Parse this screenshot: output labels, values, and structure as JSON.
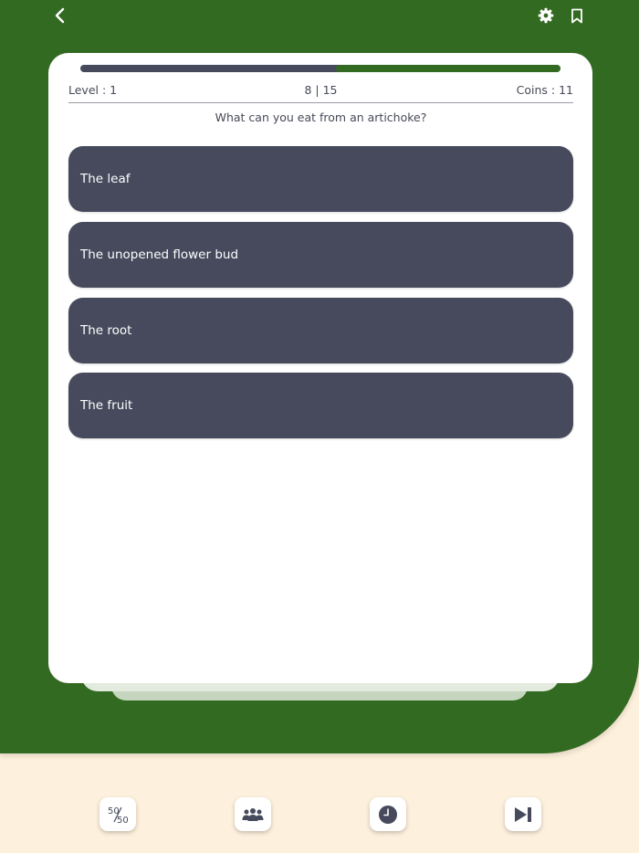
{
  "header": {
    "back_icon": "chevron-left-icon",
    "settings_icon": "gear-icon",
    "bookmark_icon": "bookmark-icon"
  },
  "progress": {
    "current": 8,
    "total": 15,
    "color_done": "#336a21",
    "color_remaining": "#464a5c"
  },
  "stats": {
    "level": "Level : 1",
    "question_count": "8 | 15",
    "coins": "Coins : 11"
  },
  "question": {
    "text": "What can you eat from an artichoke?"
  },
  "answers": [
    {
      "label": "The leaf"
    },
    {
      "label": "The unopened flower bud"
    },
    {
      "label": "The root"
    },
    {
      "label": "The fruit"
    }
  ],
  "lifelines": [
    {
      "name": "fifty-fifty",
      "icon": "fifty-fifty-icon",
      "text": "50/50"
    },
    {
      "name": "audience",
      "icon": "people-icon"
    },
    {
      "name": "timer",
      "icon": "clock-icon"
    },
    {
      "name": "skip",
      "icon": "skip-forward-icon"
    }
  ],
  "colors": {
    "background_green": "#336a21",
    "background_cream": "#fdf0dc",
    "answer_fill": "#464a5c",
    "text_dark": "#474a58"
  }
}
